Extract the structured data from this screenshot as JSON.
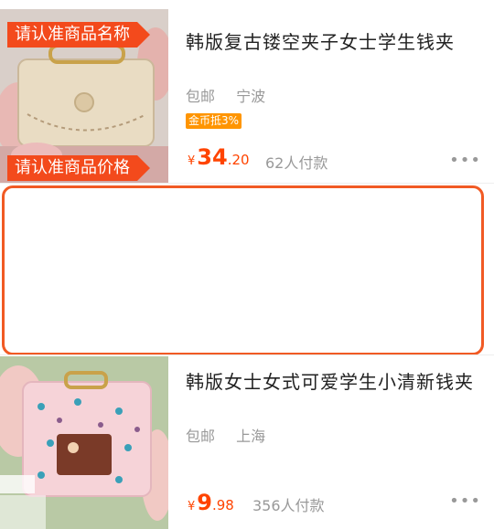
{
  "items": [
    {
      "title": "韩版复古镂空夹子女士学生钱夹",
      "shipping": "包邮",
      "location": "宁波",
      "badge": "金币抵3%",
      "price_currency": "¥",
      "price_int": "34",
      "price_dec": ".20",
      "sold": "62人付款",
      "thumbnail": "beige-wallet-image"
    },
    {
      "title": "韩版女士女式可爱学生小清新钱夹",
      "shipping": "包邮",
      "location": "上海",
      "price_currency": "¥",
      "price_int": "9",
      "price_dec": ".98",
      "sold": "356人付款",
      "thumbnail": "pink-wallet-image"
    }
  ],
  "callouts": {
    "name": "请认准商品名称",
    "price": "请认准商品价格"
  },
  "more_icon": "ellipsis-icon",
  "colors": {
    "accent": "#f34a1c",
    "price": "#ff4400",
    "badge": "#ff9500"
  }
}
